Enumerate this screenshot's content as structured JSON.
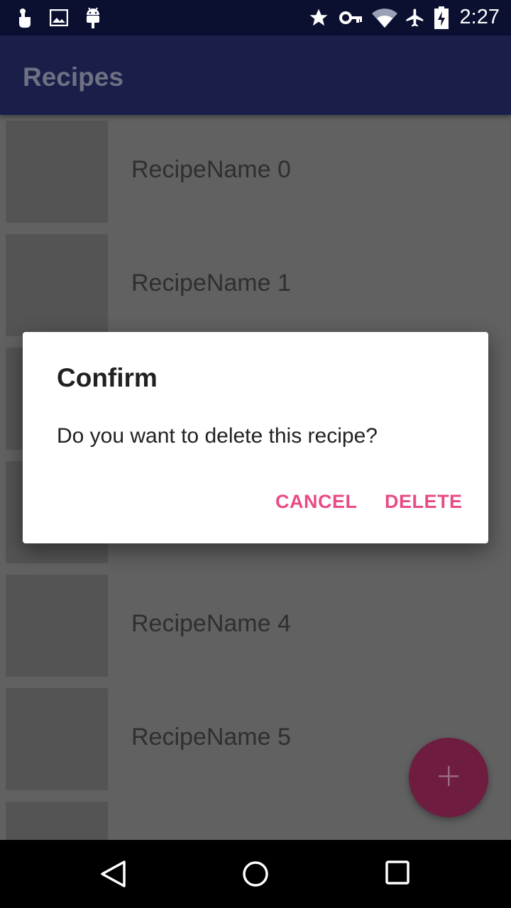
{
  "status_bar": {
    "time": "2:27",
    "left_icons": [
      "touch-icon",
      "image-icon",
      "android-debug-icon"
    ],
    "right_icons": [
      "star-icon",
      "vpn-key-icon",
      "wifi-icon",
      "airplane-icon",
      "battery-charging-icon"
    ]
  },
  "app_bar": {
    "title": "Recipes"
  },
  "recipes": [
    {
      "name": "RecipeName 0"
    },
    {
      "name": "RecipeName 1"
    },
    {
      "name": ""
    },
    {
      "name": ""
    },
    {
      "name": "RecipeName 4"
    },
    {
      "name": "RecipeName 5"
    },
    {
      "name": ""
    }
  ],
  "dialog": {
    "title": "Confirm",
    "message": "Do you want to delete this recipe?",
    "cancel_label": "CANCEL",
    "delete_label": "DELETE"
  },
  "fab": {
    "icon": "add-icon"
  },
  "nav_bar": {
    "icons": [
      "back-icon",
      "home-icon",
      "recents-icon"
    ]
  },
  "colors": {
    "accent": "#e94b86",
    "primary": "#1a1f4a",
    "status_bar": "#0b0f30",
    "fab": "#6e1c3f"
  }
}
